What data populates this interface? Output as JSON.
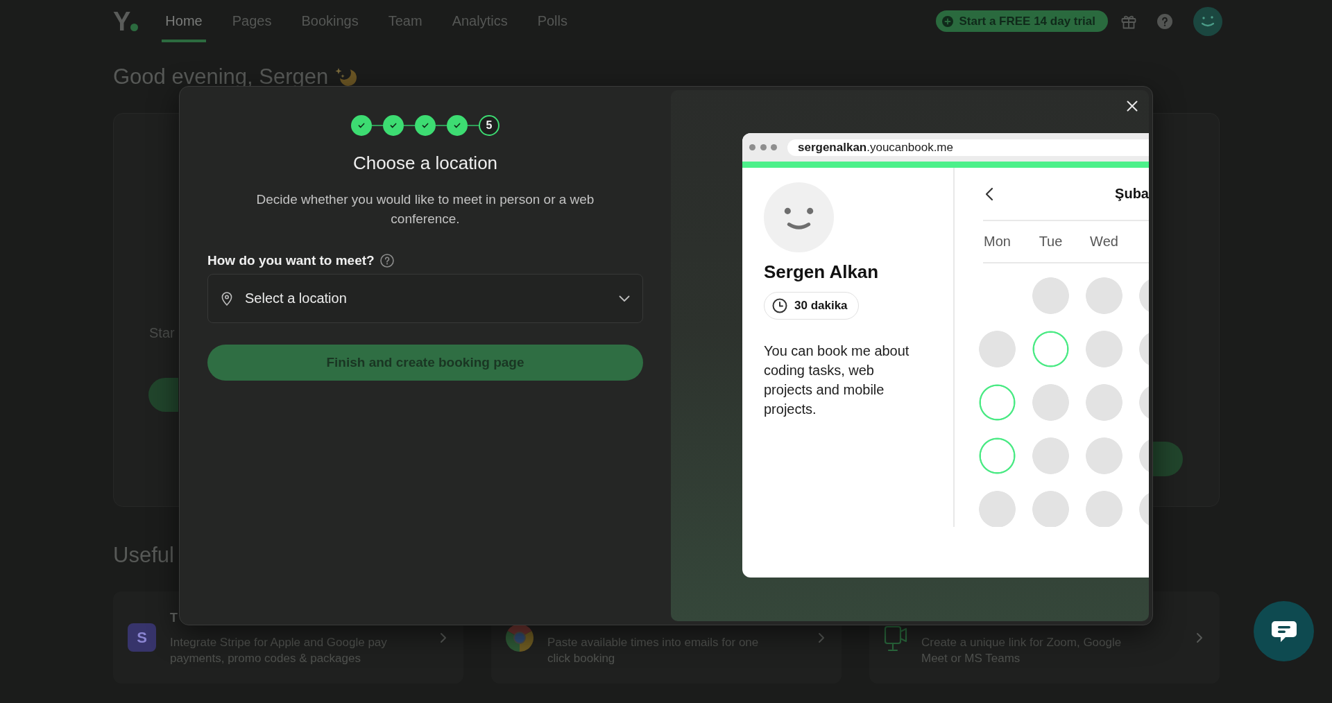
{
  "nav": {
    "logo": "Y",
    "tabs": [
      {
        "label": "Home",
        "selected": true
      },
      {
        "label": "Pages",
        "selected": false
      },
      {
        "label": "Bookings",
        "selected": false
      },
      {
        "label": "Team",
        "selected": false
      },
      {
        "label": "Analytics",
        "selected": false
      },
      {
        "label": "Polls",
        "selected": false
      }
    ],
    "trial_button": "Start a FREE 14 day trial"
  },
  "greeting": "Good evening, Sergen",
  "hero_card": {
    "text": "Star"
  },
  "section_title": "Useful",
  "resource_cards": [
    {
      "kind": "letter",
      "letter": "S",
      "title": "T",
      "description": "Integrate Stripe for Apple and Google pay\npayments, promo codes & packages"
    },
    {
      "kind": "wheel",
      "description": "Paste available times into emails for one\nclick booking"
    },
    {
      "kind": "camera",
      "description": "Create a unique link for Zoom, Google\nMeet or MS Teams"
    }
  ],
  "modal": {
    "steps": [
      {
        "done": true
      },
      {
        "done": true
      },
      {
        "done": true
      },
      {
        "done": true
      },
      {
        "done": false,
        "label": "5"
      }
    ],
    "title": "Choose a location",
    "description": "Decide whether you would like to meet in person or a web conference.",
    "question": "How do you want to meet?",
    "location_select": {
      "placeholder": "Select a location"
    },
    "finish_button": {
      "label": "Finish and create booking page",
      "disabled": true
    },
    "preview": {
      "url": "**sergenalkan**.youcanbook.me",
      "name": "Sergen Alkan",
      "duration": "30 dakika",
      "bio": "You can book me about coding tasks, web projects and mobile projects.",
      "month": "Şuba",
      "weekdays": [
        "Mon",
        "Tue",
        "Wed"
      ],
      "slot_rows": [
        {
          "slots": [
            {
              "kind": "empty"
            },
            {
              "kind": "busy"
            },
            {
              "kind": "busy"
            },
            {
              "kind": "busy"
            }
          ]
        },
        {
          "slots": [
            {
              "kind": "busy"
            },
            {
              "kind": "free"
            },
            {
              "kind": "busy"
            },
            {
              "kind": "busy"
            }
          ]
        },
        {
          "slots": [
            {
              "kind": "free"
            },
            {
              "kind": "busy"
            },
            {
              "kind": "busy"
            },
            {
              "kind": "busy"
            }
          ]
        },
        {
          "slots": [
            {
              "kind": "free"
            },
            {
              "kind": "busy"
            },
            {
              "kind": "busy"
            },
            {
              "kind": "busy"
            }
          ]
        },
        {
          "slots": [
            {
              "kind": "busy"
            },
            {
              "kind": "busy"
            },
            {
              "kind": "busy"
            },
            {
              "kind": "busy"
            }
          ]
        }
      ]
    }
  }
}
